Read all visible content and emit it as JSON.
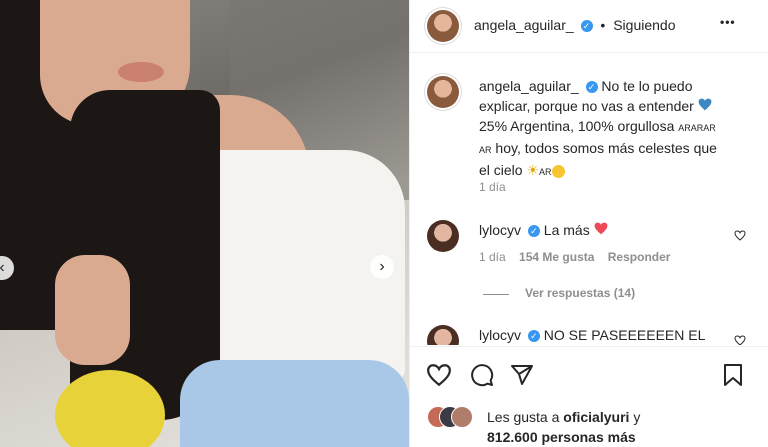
{
  "header": {
    "username": "angela_aguilar_",
    "dot": "•",
    "follow_status": "Siguiendo",
    "more": "•••"
  },
  "caption": {
    "username": "angela_aguilar_",
    "line1": "No te lo puedo",
    "line2": "explicar, porque no vas a entender",
    "line3": "25% Argentina, 100% orgullosa",
    "flags_a": "ARARAR",
    "flags_b": "AR",
    "line4": "hoy, todos somos más celestes que",
    "line5": "el cielo",
    "flags_c": "AR",
    "time": "1 día"
  },
  "comments": [
    {
      "username": "lylocyv",
      "text": "La más",
      "time": "1 día",
      "likes": "154 Me gusta",
      "reply": "Responder"
    },
    {
      "username": "lylocyv",
      "text": "NO SE PASEEEEEEN EL"
    }
  ],
  "replies_link": "Ver respuestas (14)",
  "likes": {
    "prefix": "Les gusta a",
    "user": "oficialyuri",
    "suffix": "y",
    "count_line": "812.600 personas más"
  },
  "icons": [
    "heart-icon",
    "comment-icon",
    "share-icon",
    "bookmark-icon",
    "verified-icon",
    "more-icon",
    "chevron-left-icon",
    "chevron-right-icon"
  ],
  "colors": {
    "verified": "#3897f0",
    "heart_red": "#ed4956",
    "heart_blue": "#3b88c3"
  }
}
